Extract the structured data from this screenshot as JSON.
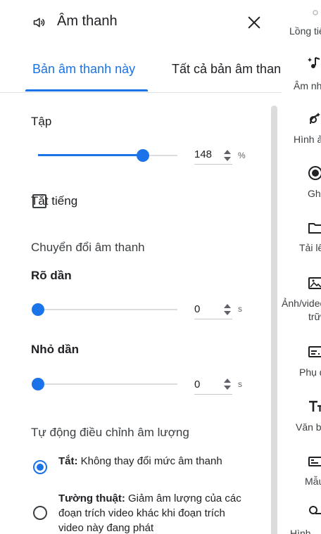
{
  "header": {
    "title": "Âm thanh",
    "speaker_icon": "speaker-icon",
    "close_icon": "close-icon"
  },
  "tabs": [
    {
      "label": "Bản âm thanh này",
      "active": true
    },
    {
      "label": "Tất cả bản âm thanh",
      "active": false
    }
  ],
  "volume": {
    "label": "Tập",
    "value": "148",
    "unit": "%",
    "level_fraction": 0.75
  },
  "mute": {
    "label": "Tắt tiếng",
    "checked": false
  },
  "transitions": {
    "heading": "Chuyển đổi âm thanh",
    "fade_in": {
      "label": "Rõ dần",
      "value": "0",
      "unit": "s",
      "level_fraction": 0
    },
    "fade_out": {
      "label": "Nhỏ dần",
      "value": "0",
      "unit": "s",
      "level_fraction": 0
    }
  },
  "auto_volume": {
    "heading": "Tự động điều chỉnh âm lượng",
    "options": [
      {
        "title": "Tắt:",
        "desc": " Không thay đổi mức âm thanh",
        "checked": true
      },
      {
        "title": "Tường thuật:",
        "desc": " Giảm âm lượng của các đoạn trích video khác khi đoạn trích video này đang phát",
        "checked": false
      }
    ]
  },
  "rail": [
    {
      "label": "Lồng tiếng",
      "icon": "voiceover-icon"
    },
    {
      "label": "Âm nhạc",
      "icon": "music-note-icon"
    },
    {
      "label": "Hình ảnh",
      "icon": "image-icon"
    },
    {
      "label": "Ghi",
      "icon": "record-icon"
    },
    {
      "label": "Tải lên",
      "icon": "folder-icon"
    },
    {
      "label": "Ảnh/video",
      "label2": "trữ",
      "icon": "stock-media-icon"
    },
    {
      "label": "Phụ đề",
      "icon": "captions-icon"
    },
    {
      "label": "Văn bản",
      "icon": "text-icon"
    },
    {
      "label": "Mẫu",
      "icon": "template-icon"
    },
    {
      "label": "Hình",
      "icon": "shapes-icon"
    }
  ],
  "colors": {
    "accent": "#1a73e8",
    "text": "#202124",
    "divider": "#e0e0e0",
    "scrollbar": "#dcdcdc"
  }
}
